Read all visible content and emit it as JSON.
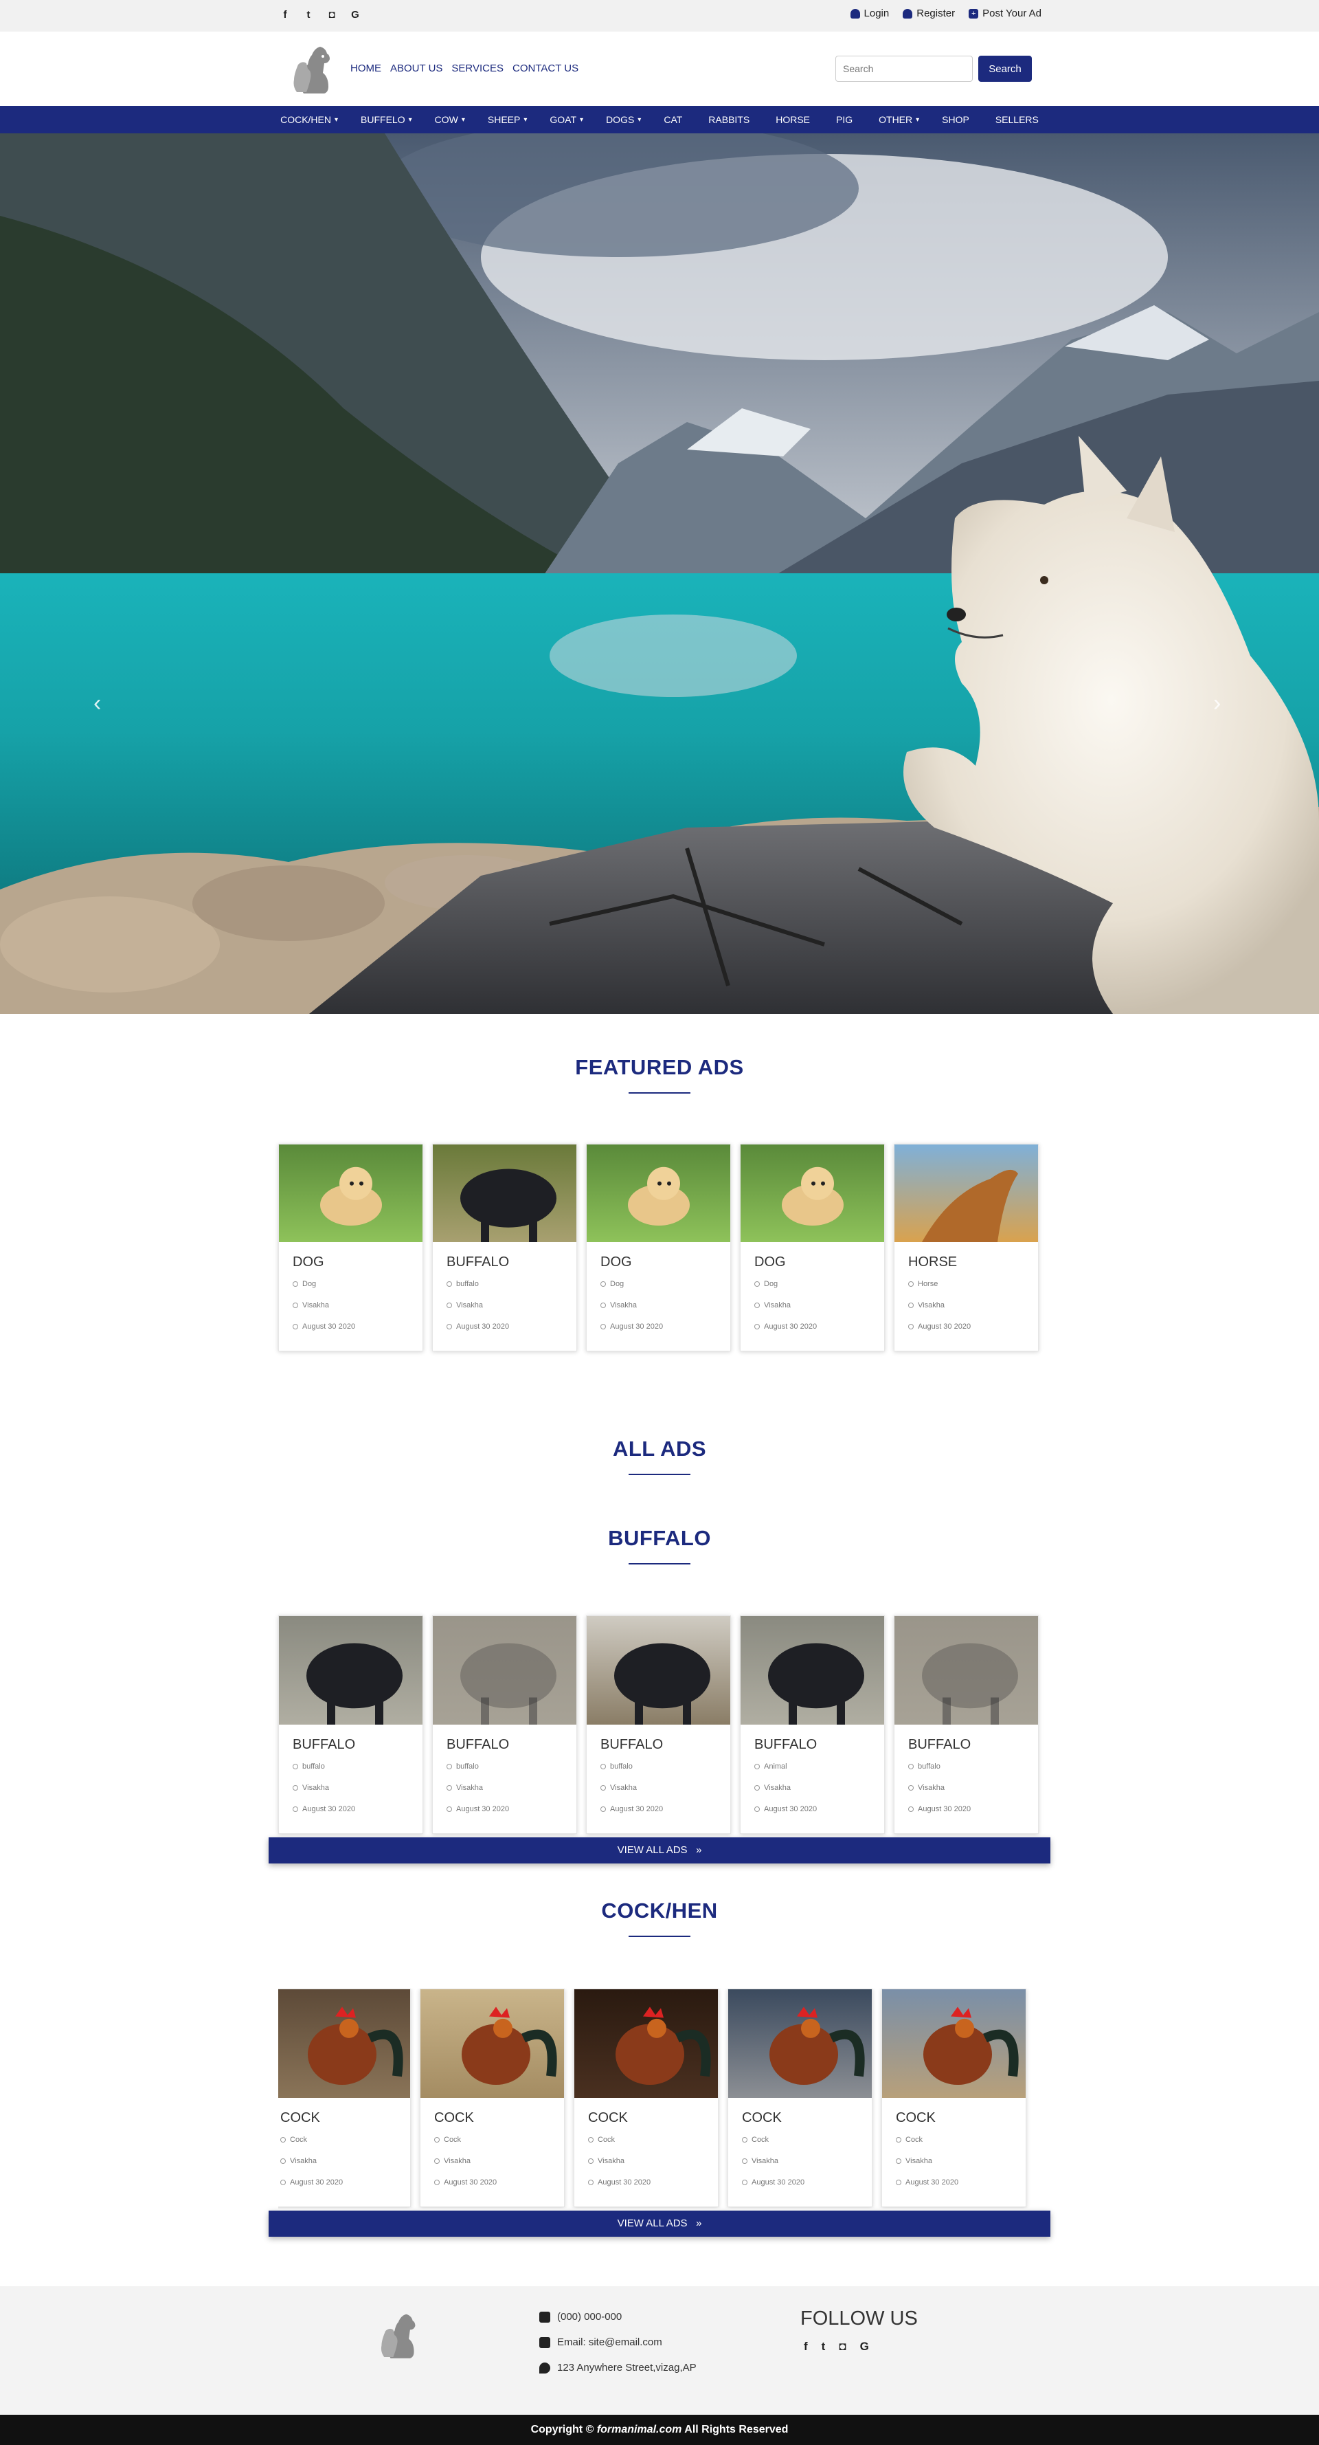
{
  "topbar": {
    "social": [
      {
        "icon": "facebook-icon",
        "glyph": "f"
      },
      {
        "icon": "twitter-icon",
        "glyph": "t"
      },
      {
        "icon": "instagram-icon",
        "glyph": "◘"
      },
      {
        "icon": "google-icon",
        "glyph": "G"
      }
    ],
    "login": "Login",
    "register": "Register",
    "post_ad": "Post Your Ad"
  },
  "header": {
    "nav": [
      "HOME",
      "ABOUT US",
      "SERVICES",
      "CONTACT US"
    ],
    "search_placeholder": "Search",
    "search_button": "Search"
  },
  "catnav": [
    {
      "label": "COCK/HEN",
      "dropdown": true
    },
    {
      "label": "BUFFELO",
      "dropdown": true
    },
    {
      "label": "COW",
      "dropdown": true
    },
    {
      "label": "SHEEP",
      "dropdown": true
    },
    {
      "label": "GOAT",
      "dropdown": true
    },
    {
      "label": "DOGS",
      "dropdown": true
    },
    {
      "label": "CAT",
      "dropdown": false
    },
    {
      "label": "RABBITS",
      "dropdown": false
    },
    {
      "label": "HORSE",
      "dropdown": false
    },
    {
      "label": "PIG",
      "dropdown": false
    },
    {
      "label": "OTHER",
      "dropdown": true
    },
    {
      "label": "SHOP",
      "dropdown": false
    },
    {
      "label": "SELLERS",
      "dropdown": false
    }
  ],
  "hero": {
    "prev": "‹",
    "next": "›",
    "slides": 3,
    "active": 0
  },
  "featured": {
    "title": "FEATURED ADS",
    "cards": [
      {
        "name": "DOG",
        "category": "Dog",
        "location": "Visakha",
        "date": "August 30 2020",
        "photo": "dog"
      },
      {
        "name": "BUFFALO",
        "category": "buffalo",
        "location": "Visakha",
        "date": "August 30 2020",
        "photo": "buffalo-field"
      },
      {
        "name": "DOG",
        "category": "Dog",
        "location": "Visakha",
        "date": "August 30 2020",
        "photo": "dog"
      },
      {
        "name": "DOG",
        "category": "Dog",
        "location": "Visakha",
        "date": "August 30 2020",
        "photo": "dog"
      },
      {
        "name": "HORSE",
        "category": "Horse",
        "location": "Visakha",
        "date": "August 30 2020",
        "photo": "horse"
      }
    ]
  },
  "all_ads_title": "ALL ADS",
  "buffalo": {
    "title": "BUFFALO",
    "cards": [
      {
        "name": "BUFFALO",
        "category": "buffalo",
        "location": "Visakha",
        "date": "August 30 2020",
        "photo": "buffalo"
      },
      {
        "name": "BUFFALO",
        "category": "buffalo",
        "location": "Visakha",
        "date": "August 30 2020",
        "photo": "buffalo-faded"
      },
      {
        "name": "BUFFALO",
        "category": "buffalo",
        "location": "Visakha",
        "date": "August 30 2020",
        "photo": "buffalo-stall"
      },
      {
        "name": "BUFFALO",
        "category": "Animal",
        "location": "Visakha",
        "date": "August 30 2020",
        "photo": "buffalo"
      },
      {
        "name": "BUFFALO",
        "category": "buffalo",
        "location": "Visakha",
        "date": "August 30 2020",
        "photo": "buffalo-faded"
      }
    ],
    "view_all": "VIEW ALL ADS"
  },
  "cock": {
    "title": "COCK/HEN",
    "cards": [
      {
        "name": "COCK",
        "category": "Cock",
        "location": "Visakha",
        "date": "August 30 2020",
        "photo": "hens"
      },
      {
        "name": "COCK",
        "category": "Cock",
        "location": "Visakha",
        "date": "August 30 2020",
        "photo": "rooster"
      },
      {
        "name": "COCK",
        "category": "Cock",
        "location": "Visakha",
        "date": "August 30 2020",
        "photo": "rooster-dark"
      },
      {
        "name": "COCK",
        "category": "Cock",
        "location": "Visakha",
        "date": "August 30 2020",
        "photo": "rooster-color"
      },
      {
        "name": "COCK",
        "category": "Cock",
        "location": "Visakha",
        "date": "August 30 2020",
        "photo": "hen"
      }
    ],
    "view_all": "VIEW ALL ADS"
  },
  "footer": {
    "phone": "(000) 000-000",
    "email": "Email: site@email.com",
    "address": "123 Anywhere Street,vizag,AP",
    "follow": "FOLLOW US",
    "copyright_prefix": "Copyright ©",
    "copyright_site": "formanimal.com",
    "copyright_suffix": "All Rights Reserved"
  },
  "colors": {
    "brand": "#1c2a7e",
    "topbar": "#f1f1f1",
    "footer": "#f3f3f3",
    "copyright": "#111111"
  }
}
